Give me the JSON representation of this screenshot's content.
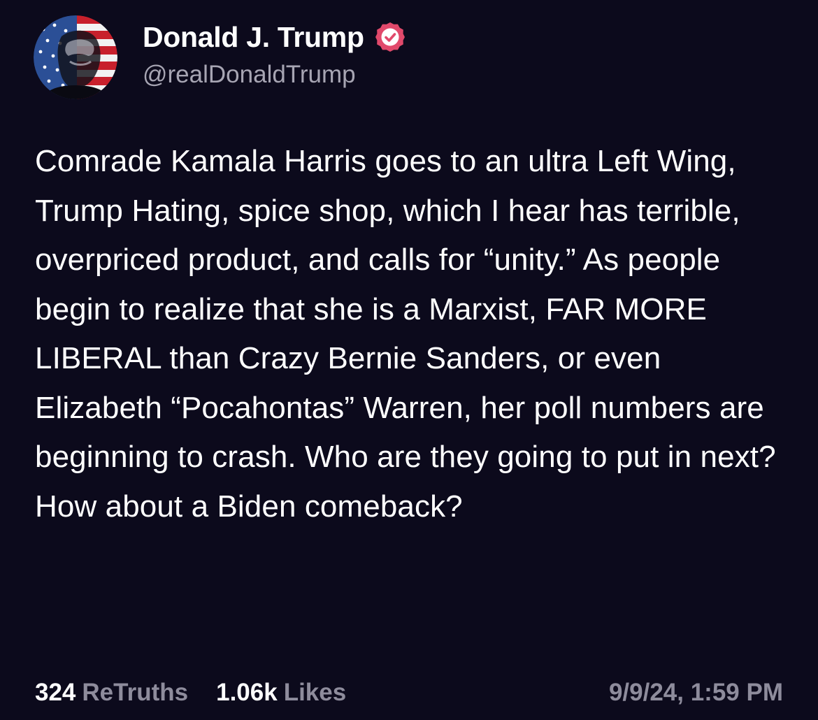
{
  "author": {
    "display_name": "Donald J. Trump",
    "handle": "@realDonaldTrump",
    "avatar_icon": "flag-portrait-avatar-icon",
    "verified_icon": "verified-badge-icon",
    "verified_color": "#e1496b"
  },
  "post": {
    "text": "Comrade Kamala Harris goes to an ultra Left Wing, Trump Hating, spice shop, which I hear has terrible, overpriced product, and calls for “unity.” As people begin to realize that she is a Marxist, FAR MORE LIBERAL than Crazy Bernie Sanders, or even Elizabeth “Pocahontas” Warren, her poll numbers are beginning to crash. Who are they going to put in next? How about a Biden comeback?"
  },
  "stats": {
    "retruths_count": "324",
    "retruths_label": "ReTruths",
    "likes_count": "1.06k",
    "likes_label": "Likes",
    "timestamp": "9/9/24, 1:59 PM"
  },
  "colors": {
    "background": "#0c0a1c",
    "primary_text": "#ffffff",
    "secondary_text": "#8e8c9c"
  }
}
